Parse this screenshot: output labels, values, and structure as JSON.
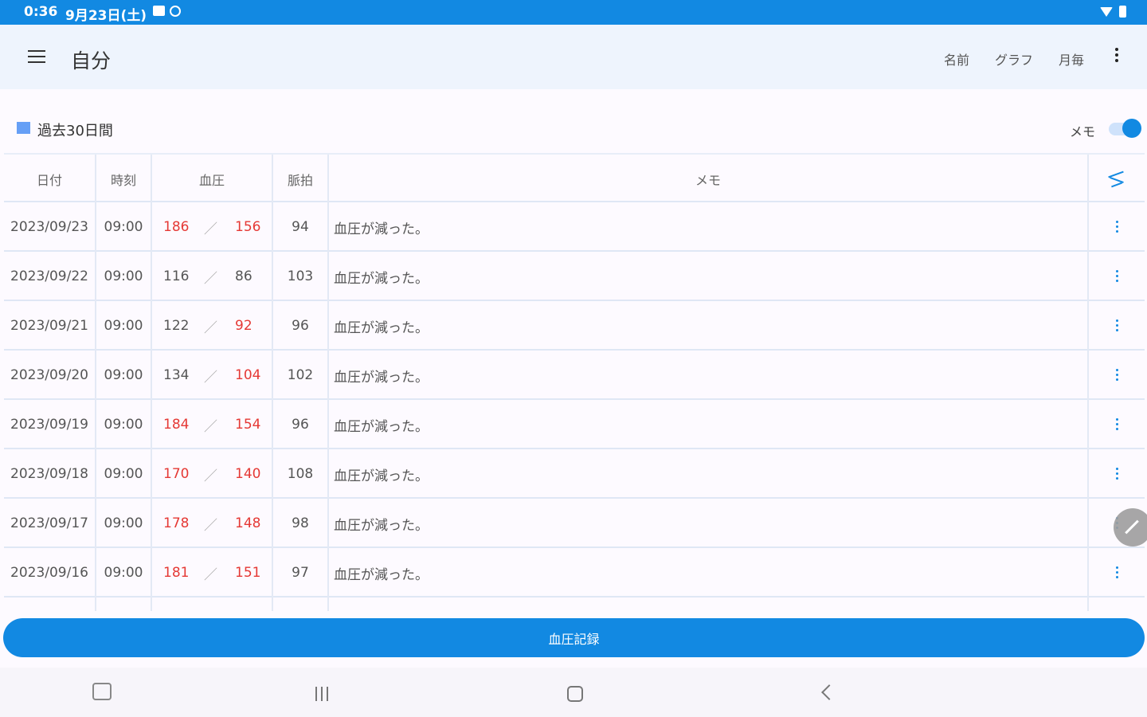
{
  "status_bar": {
    "time": "0:36",
    "date": "9月23日(土)"
  },
  "app_bar": {
    "title": "自分",
    "actions": [
      "名前",
      "グラフ",
      "月毎"
    ]
  },
  "period": {
    "label": "過去30日間",
    "memo_toggle_label": "メモ",
    "memo_toggle_on": true
  },
  "table": {
    "headers": [
      "日付",
      "時刻",
      "血圧",
      "脈拍",
      "メモ"
    ],
    "rows": [
      {
        "date": "2023/09/23",
        "time": "09:00",
        "sys": "186",
        "dia": "156",
        "pulse": "94",
        "memo": "血圧が減った。"
      },
      {
        "date": "2023/09/22",
        "time": "09:00",
        "sys": "116",
        "dia": "86",
        "pulse": "103",
        "memo": "血圧が減った。"
      },
      {
        "date": "2023/09/21",
        "time": "09:00",
        "sys": "122",
        "dia": "92",
        "pulse": "96",
        "memo": "血圧が減った。"
      },
      {
        "date": "2023/09/20",
        "time": "09:00",
        "sys": "134",
        "dia": "104",
        "pulse": "102",
        "memo": "血圧が減った。"
      },
      {
        "date": "2023/09/19",
        "time": "09:00",
        "sys": "184",
        "dia": "154",
        "pulse": "96",
        "memo": "血圧が減った。"
      },
      {
        "date": "2023/09/18",
        "time": "09:00",
        "sys": "170",
        "dia": "140",
        "pulse": "108",
        "memo": "血圧が減った。"
      },
      {
        "date": "2023/09/17",
        "time": "09:00",
        "sys": "178",
        "dia": "148",
        "pulse": "98",
        "memo": "血圧が減った。"
      },
      {
        "date": "2023/09/16",
        "time": "09:00",
        "sys": "181",
        "dia": "151",
        "pulse": "97",
        "memo": "血圧が減った。"
      }
    ],
    "high_values": [
      {
        "sys": true,
        "dia": true
      },
      {
        "sys": false,
        "dia": false
      },
      {
        "sys": false,
        "dia": true
      },
      {
        "sys": false,
        "dia": true
      },
      {
        "sys": true,
        "dia": true
      },
      {
        "sys": true,
        "dia": true
      },
      {
        "sys": true,
        "dia": true
      },
      {
        "sys": true,
        "dia": true
      }
    ]
  },
  "record_button": {
    "label": "血圧記録"
  },
  "colors": {
    "primary": "#1289e2",
    "high": "#e53935",
    "appbar": "#eef4fd"
  }
}
